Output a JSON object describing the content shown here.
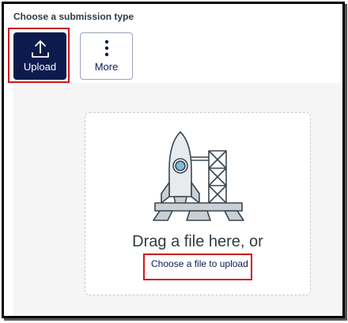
{
  "header": {
    "title": "Choose a submission type"
  },
  "submission_types": [
    {
      "label": "Upload",
      "icon": "upload-icon",
      "selected": true
    },
    {
      "label": "More",
      "icon": "more-vertical-icon",
      "selected": false
    }
  ],
  "dropzone": {
    "illustration": "rocket-launchpad-illustration",
    "drag_text": "Drag a file here, or",
    "choose_link": "Choose a file to upload"
  },
  "colors": {
    "primary": "#0c1b4c",
    "highlight": "#d0151c",
    "text": "#2d3b45",
    "panel_bg": "#f5f5f5"
  }
}
